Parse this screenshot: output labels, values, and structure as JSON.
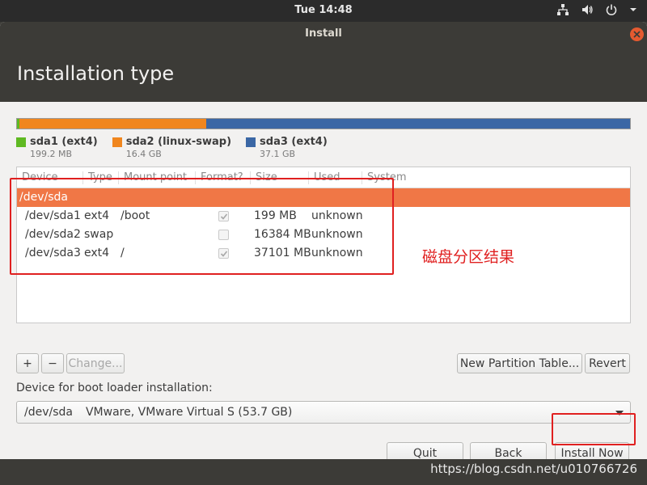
{
  "top_panel": {
    "clock": "Tue 14:48",
    "icons": [
      "network-icon",
      "volume-icon",
      "power-icon",
      "chevron-down-icon"
    ]
  },
  "window": {
    "title": "Install"
  },
  "header": {
    "title": "Installation type"
  },
  "partitions_bar": {
    "segments": [
      {
        "name": "sda1 (ext4)",
        "size": "199.2 MB",
        "color": "#5fb922",
        "fraction": 0.004
      },
      {
        "name": "sda2 (linux-swap)",
        "size": "16.4 GB",
        "color": "#f0861e",
        "fraction": 0.305
      },
      {
        "name": "sda3 (ext4)",
        "size": "37.1 GB",
        "color": "#3b67a5",
        "fraction": 0.691
      }
    ]
  },
  "table": {
    "columns": [
      "Device",
      "Type",
      "Mount point",
      "Format?",
      "Size",
      "Used",
      "System"
    ],
    "disk_row": "/dev/sda",
    "rows": [
      {
        "device": "/dev/sda1",
        "type": "ext4",
        "mount": "/boot",
        "format": true,
        "size": "199 MB",
        "used": "unknown"
      },
      {
        "device": "/dev/sda2",
        "type": "swap",
        "mount": "",
        "format": false,
        "size": "16384 MB",
        "used": "unknown"
      },
      {
        "device": "/dev/sda3",
        "type": "ext4",
        "mount": "/",
        "format": true,
        "size": "37101 MB",
        "used": "unknown"
      }
    ]
  },
  "buttons": {
    "add": "+",
    "remove": "−",
    "change": "Change...",
    "new_table": "New Partition Table...",
    "revert": "Revert",
    "quit": "Quit",
    "back": "Back",
    "install": "Install Now"
  },
  "boot_loader": {
    "label": "Device for boot loader installation:",
    "device": "/dev/sda",
    "description": "VMware, VMware Virtual S (53.7 GB)"
  },
  "annotation": {
    "text": "磁盘分区结果",
    "color": "#e02020"
  },
  "watermark": "https://blog.csdn.net/u010766726"
}
